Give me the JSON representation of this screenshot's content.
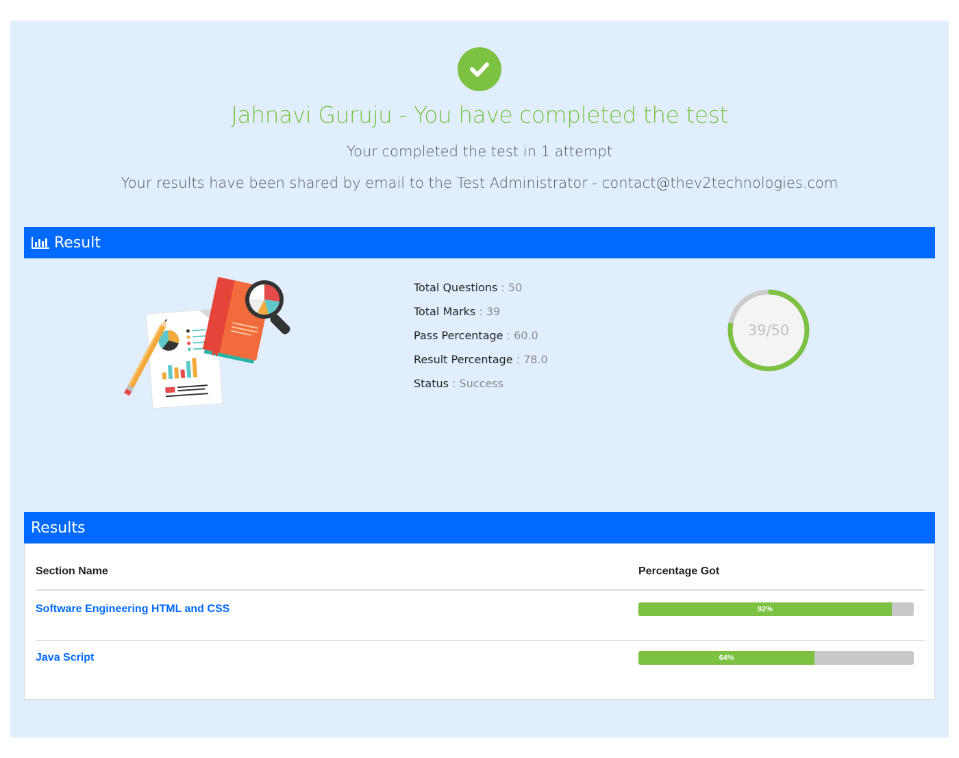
{
  "header": {
    "title": "Jahnavi Guruju - You have completed the test",
    "attempts_text": "Your completed the test in 1 attempt",
    "shared_text": "Your results have been shared by email to the Test Administrator - contact@thev2technologies.com",
    "check_icon": "check-circle-icon",
    "accent_color": "#7cc142"
  },
  "result_panel": {
    "heading": "Result",
    "heading_icon": "bar-chart-icon",
    "header_color": "#0069ff",
    "stats": [
      {
        "label": "Total Questions",
        "sep": " : ",
        "value": "50"
      },
      {
        "label": "Total Marks",
        "sep": " : ",
        "value": "39"
      },
      {
        "label": "Pass Percentage",
        "sep": " : ",
        "value": "60.0"
      },
      {
        "label": "Result Percentage",
        "sep": " : ",
        "value": "78.0"
      },
      {
        "label": "Status",
        "sep": " : ",
        "value": "Success"
      }
    ],
    "score": {
      "text": "39/50",
      "got": 39,
      "total": 50,
      "ring_color": "#7cc142",
      "track_color": "#cccccc"
    }
  },
  "results_table": {
    "heading": "Results",
    "columns": [
      "Section Name",
      "Percentage Got"
    ],
    "rows": [
      {
        "section": "Software Engineering HTML and CSS",
        "percent_label": "92%",
        "percent": 92
      },
      {
        "section": "Java Script",
        "percent_label": "64%",
        "percent": 64
      }
    ]
  }
}
